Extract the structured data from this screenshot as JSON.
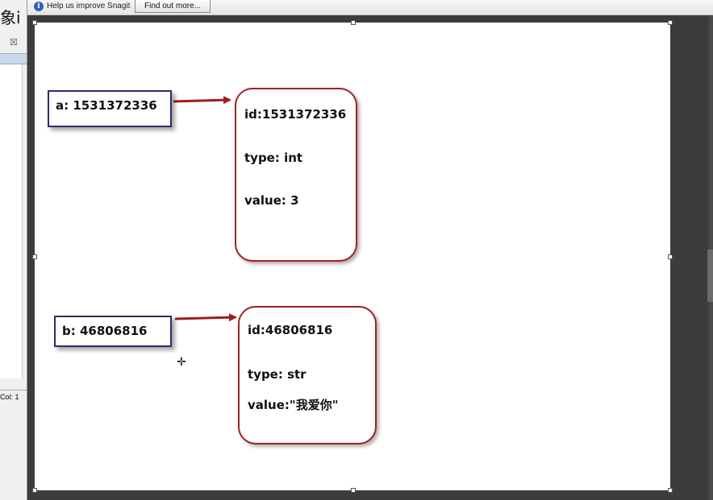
{
  "left_window": {
    "title_fragment": "象i",
    "close_glyph": "☒",
    "status_text": "Col: 1"
  },
  "notification": {
    "icon": "info-icon",
    "message": "Help us improve Snagit",
    "button_label": "Find out more..."
  },
  "diagram": {
    "a": {
      "label": "a: 1531372336",
      "object": {
        "id": "id:1531372336",
        "type": "type: int",
        "value": "value:  3"
      }
    },
    "b": {
      "label": "b: 46806816",
      "object": {
        "id": "id:46806816",
        "type": "type: str",
        "value": "value:\"我爱你\""
      }
    }
  },
  "colors": {
    "var_border": "#2c2c6e",
    "object_border": "#a02228",
    "arrow": "#a01c1c"
  },
  "cursor_icon": "move-cursor-icon"
}
